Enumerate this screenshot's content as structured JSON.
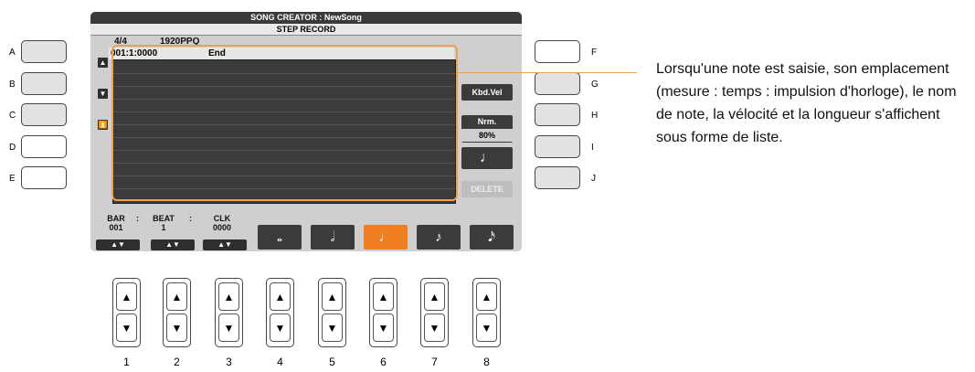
{
  "screen": {
    "title": "SONG CREATOR : NewSong",
    "subtitle": "STEP RECORD",
    "time_sig": "4/4",
    "resolution": "1920PPQ",
    "event_position": "001:1:0000",
    "event_name": "End"
  },
  "side_buttons": {
    "left": [
      "A",
      "B",
      "C",
      "D",
      "E"
    ],
    "right": [
      "F",
      "G",
      "H",
      "I",
      "J"
    ]
  },
  "right_panel": {
    "kbd_vel": "Kbd.Vel",
    "nrm": "Nrm.",
    "percent": "80%",
    "note_icon": "♩",
    "delete": "DELETE"
  },
  "bottom": {
    "bar_label": "BAR",
    "bar_value": "001",
    "beat_label": "BEAT",
    "beat_value": "1",
    "clk_label": "CLK",
    "clk_value": "0000",
    "sep": ":",
    "arrow": "▲▼",
    "notes": [
      "𝅝",
      "𝅗𝅥",
      "♩",
      "♪",
      "𝅘𝅥𝅯"
    ]
  },
  "callout": {
    "text": "Lorsqu'une note est saisie, son emplacement (mesure : temps : impulsion d'horloge), le nom de note, la vélocité et la longueur s'affichent sous forme de liste."
  },
  "physical_buttons": {
    "up": "▲",
    "down": "▼",
    "labels": [
      "1",
      "2",
      "3",
      "4",
      "5",
      "6",
      "7",
      "8"
    ]
  },
  "colors": {
    "accent": "#f07f22",
    "highlight": "#f0a24a",
    "screen_bg": "#cfcfcf",
    "list_bg": "#3b3b3b"
  }
}
